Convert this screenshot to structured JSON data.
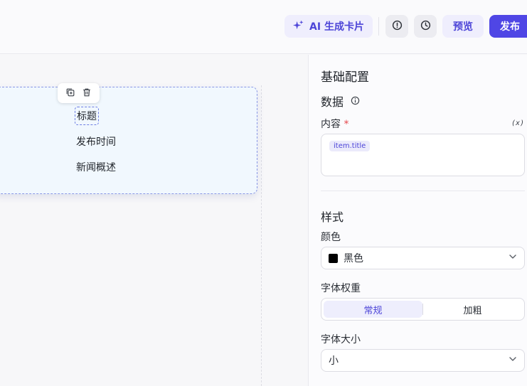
{
  "toolbar": {
    "ai_label": "AI 生成卡片",
    "preview_label": "预览",
    "publish_label": "发布"
  },
  "card": {
    "texts": [
      "标题",
      "发布时间",
      "新闻概述"
    ]
  },
  "panel": {
    "title": "基础配置",
    "data_section": "数据",
    "content_label": "内容",
    "required_mark": "*",
    "variable_icon": "(x)",
    "content_tag": "item.title",
    "style_section": "样式",
    "color_label": "颜色",
    "color_value": "黑色",
    "color_swatch": "#000000",
    "weight_label": "字体权重",
    "weight_options": [
      "常规",
      "加粗"
    ],
    "weight_selected": "常规",
    "size_label": "字体大小",
    "size_value": "小"
  },
  "colors": {
    "accent": "#4f46e5",
    "accent_soft": "#efeefd",
    "required": "#e5484d",
    "card_bg": "#f1f8fe"
  },
  "icons": [
    "sparkle-icon",
    "alert-circle-icon",
    "clock-icon",
    "copy-plus-icon",
    "trash-icon",
    "info-icon",
    "variable-icon",
    "chevron-down-icon"
  ]
}
